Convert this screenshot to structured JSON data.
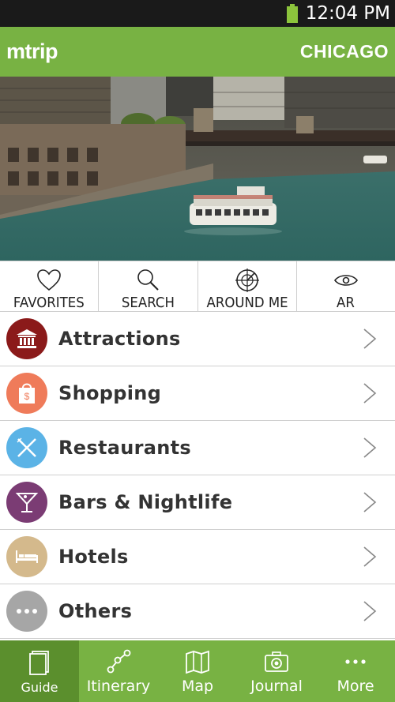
{
  "status_bar": {
    "time": "12:04 PM"
  },
  "app_bar": {
    "brand": "mtrip",
    "city": "CHICAGO"
  },
  "hero": {
    "description": "Chicago river with tour boat"
  },
  "quick_actions": [
    {
      "label": "FAVORITES",
      "icon": "heart-icon"
    },
    {
      "label": "SEARCH",
      "icon": "search-icon"
    },
    {
      "label": "AROUND ME",
      "icon": "target-icon"
    },
    {
      "label": "AR",
      "icon": "eye-icon"
    }
  ],
  "categories": [
    {
      "label": "Attractions",
      "icon": "museum-icon",
      "color": "#8b1a1a"
    },
    {
      "label": "Shopping",
      "icon": "shopping-bag-icon",
      "color": "#ef7b5a"
    },
    {
      "label": "Restaurants",
      "icon": "fork-knife-icon",
      "color": "#5bb3e6"
    },
    {
      "label": "Bars & Nightlife",
      "icon": "cocktail-icon",
      "color": "#7b3c74"
    },
    {
      "label": "Hotels",
      "icon": "bed-icon",
      "color": "#d4b98c"
    },
    {
      "label": "Others",
      "icon": "more-dots-icon",
      "color": "#a6a6a6"
    }
  ],
  "bottom_nav": [
    {
      "label": "Guide",
      "icon": "guide-book-icon",
      "active": true
    },
    {
      "label": "Itinerary",
      "icon": "itinerary-icon",
      "active": false
    },
    {
      "label": "Map",
      "icon": "map-icon",
      "active": false
    },
    {
      "label": "Journal",
      "icon": "camera-icon",
      "active": false
    },
    {
      "label": "More",
      "icon": "more-dots-icon",
      "active": false
    }
  ],
  "colors": {
    "brand_green": "#78b243",
    "active_green": "#5b8f2d",
    "status_bar": "#1a1a1a"
  }
}
